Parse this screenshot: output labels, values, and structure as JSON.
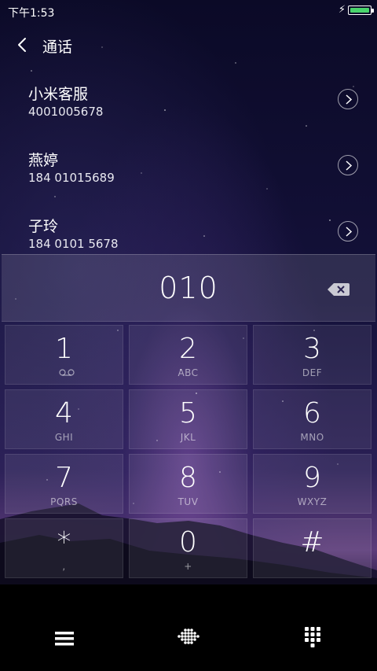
{
  "status_bar": {
    "time": "下午1:53",
    "charging_icon": "lightning-bolt",
    "battery_color": "#49d46c"
  },
  "header": {
    "back_icon": "chevron-left",
    "title": "通话"
  },
  "contacts": [
    {
      "name": "小米客服",
      "number": "4001005678"
    },
    {
      "name": "燕婷",
      "number": "184 01015689"
    },
    {
      "name": "子玲",
      "number": "184 0101 5678"
    }
  ],
  "display": {
    "digits": "010",
    "backspace_icon": "backspace-icon"
  },
  "keypad": [
    {
      "num": "1",
      "sub": ""
    },
    {
      "num": "2",
      "sub": "ABC"
    },
    {
      "num": "3",
      "sub": "DEF"
    },
    {
      "num": "4",
      "sub": "GHI"
    },
    {
      "num": "5",
      "sub": "JKL"
    },
    {
      "num": "6",
      "sub": "MNO"
    },
    {
      "num": "7",
      "sub": "PQRS"
    },
    {
      "num": "8",
      "sub": "TUV"
    },
    {
      "num": "9",
      "sub": "WXYZ"
    },
    {
      "num": "*",
      "sub": ","
    },
    {
      "num": "0",
      "sub": "+"
    },
    {
      "num": "#",
      "sub": ""
    }
  ],
  "bottom_bar": {
    "icons": [
      "menu-icon",
      "dial-icon",
      "keypad-icon"
    ]
  }
}
